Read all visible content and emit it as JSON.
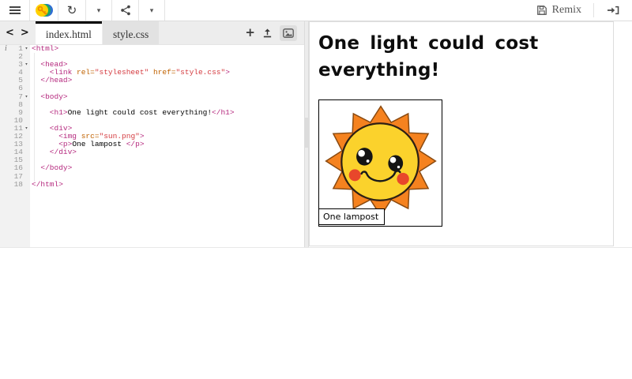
{
  "toolbar": {
    "remix_label": "Remix",
    "icons": {
      "hamburger": "≡",
      "refresh": "↻",
      "caret": "▾"
    }
  },
  "tabbar": {
    "back": "<",
    "forward": ">",
    "plus": "+",
    "tabs": [
      {
        "label": "index.html",
        "active": true
      },
      {
        "label": "style.css",
        "active": false
      }
    ]
  },
  "editor": {
    "info_marker": "i",
    "fold_marker": "▾",
    "lines": [
      {
        "num": 1,
        "fold": true,
        "segs": [
          {
            "c": "tag",
            "t": "<html>"
          }
        ]
      },
      {
        "num": 2,
        "segs": []
      },
      {
        "num": 3,
        "fold": true,
        "segs": [
          {
            "c": "tag",
            "t": "  <head>"
          }
        ]
      },
      {
        "num": 4,
        "segs": [
          {
            "c": "tag",
            "t": "    <link"
          },
          {
            "c": "attr",
            "t": " rel="
          },
          {
            "c": "val",
            "t": "\"stylesheet\""
          },
          {
            "c": "attr",
            "t": " href="
          },
          {
            "c": "val",
            "t": "\"style.css\""
          },
          {
            "c": "tag",
            "t": ">"
          }
        ]
      },
      {
        "num": 5,
        "segs": [
          {
            "c": "tag",
            "t": "  </head>"
          }
        ]
      },
      {
        "num": 6,
        "segs": []
      },
      {
        "num": 7,
        "fold": true,
        "segs": [
          {
            "c": "tag",
            "t": "  <body>"
          }
        ]
      },
      {
        "num": 8,
        "segs": []
      },
      {
        "num": 9,
        "segs": [
          {
            "c": "tag",
            "t": "    <h1>"
          },
          {
            "c": "text",
            "t": "One light could cost everything!"
          },
          {
            "c": "tag",
            "t": "</h1>"
          }
        ]
      },
      {
        "num": 10,
        "segs": []
      },
      {
        "num": 11,
        "fold": true,
        "segs": [
          {
            "c": "tag",
            "t": "    <div>"
          }
        ]
      },
      {
        "num": 12,
        "segs": [
          {
            "c": "tag",
            "t": "      <img"
          },
          {
            "c": "attr",
            "t": " src="
          },
          {
            "c": "val",
            "t": "\"sun.png\""
          },
          {
            "c": "tag",
            "t": ">"
          }
        ]
      },
      {
        "num": 13,
        "segs": [
          {
            "c": "tag",
            "t": "      <p>"
          },
          {
            "c": "text",
            "t": "One lampost "
          },
          {
            "c": "tag",
            "t": "</p>"
          }
        ]
      },
      {
        "num": 14,
        "segs": [
          {
            "c": "tag",
            "t": "    </div>"
          }
        ]
      },
      {
        "num": 15,
        "segs": []
      },
      {
        "num": 16,
        "segs": [
          {
            "c": "tag",
            "t": "  </body>"
          }
        ]
      },
      {
        "num": 17,
        "segs": []
      },
      {
        "num": 18,
        "segs": [
          {
            "c": "tag",
            "t": "</html>"
          }
        ]
      }
    ]
  },
  "preview": {
    "heading": "One light could cost everything!",
    "caption": "One lampost",
    "sun": {
      "ray": "#f5821f",
      "ray_outline": "#8a4a10",
      "face": "#fbd22c",
      "face_outline": "#2e2014",
      "eye": "#141414",
      "highlight": "#ffffff",
      "cheek": "#e8472b",
      "smile": "#1a1a1a"
    }
  },
  "colors": {
    "active_tab_border": "#000000",
    "token_tag": "#b5297e",
    "token_attr": "#c06200",
    "token_val": "#d43a3f",
    "gutter_bg": "#f2f2f2",
    "toolbar_text": "#555555"
  }
}
